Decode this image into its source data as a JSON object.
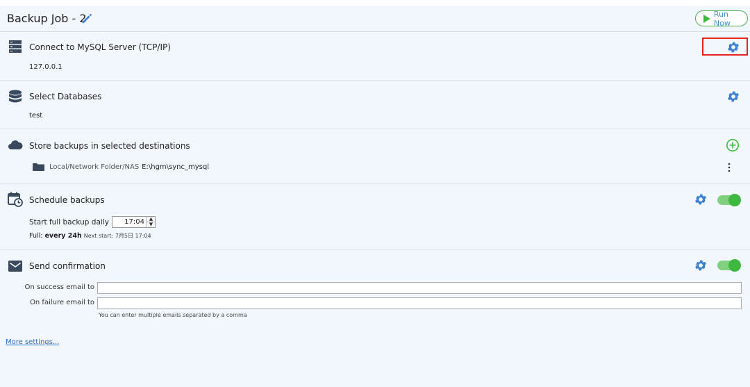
{
  "header": {
    "title": "Backup Job - 2",
    "run_label": "Run Now"
  },
  "connect": {
    "title": "Connect to MySQL Server (TCP/IP)",
    "host": "127.0.0.1"
  },
  "databases": {
    "title": "Select Databases",
    "selected": "test"
  },
  "destinations": {
    "title": "Store backups in selected destinations",
    "items": [
      {
        "type": "Local/Network Folder/NAS",
        "path": "E:\\hgm\\sync_mysql"
      }
    ]
  },
  "schedule": {
    "title": "Schedule backups",
    "start_label": "Start full backup daily at",
    "time": "17:04",
    "full_prefix": "Full:",
    "full_value": "every 24h",
    "next_start": "Next start: 7月5日 17:04",
    "enabled": true
  },
  "confirmation": {
    "title": "Send confirmation",
    "success_label": "On success email to",
    "success_value": "",
    "failure_label": "On failure email to",
    "failure_value": "",
    "hint": "You can enter multiple emails separated by a comma",
    "enabled": true
  },
  "more_settings": "More settings...",
  "colors": {
    "accent_blue": "#3d7fd1",
    "green": "#3fb83f",
    "highlight_red": "#e8231f"
  }
}
